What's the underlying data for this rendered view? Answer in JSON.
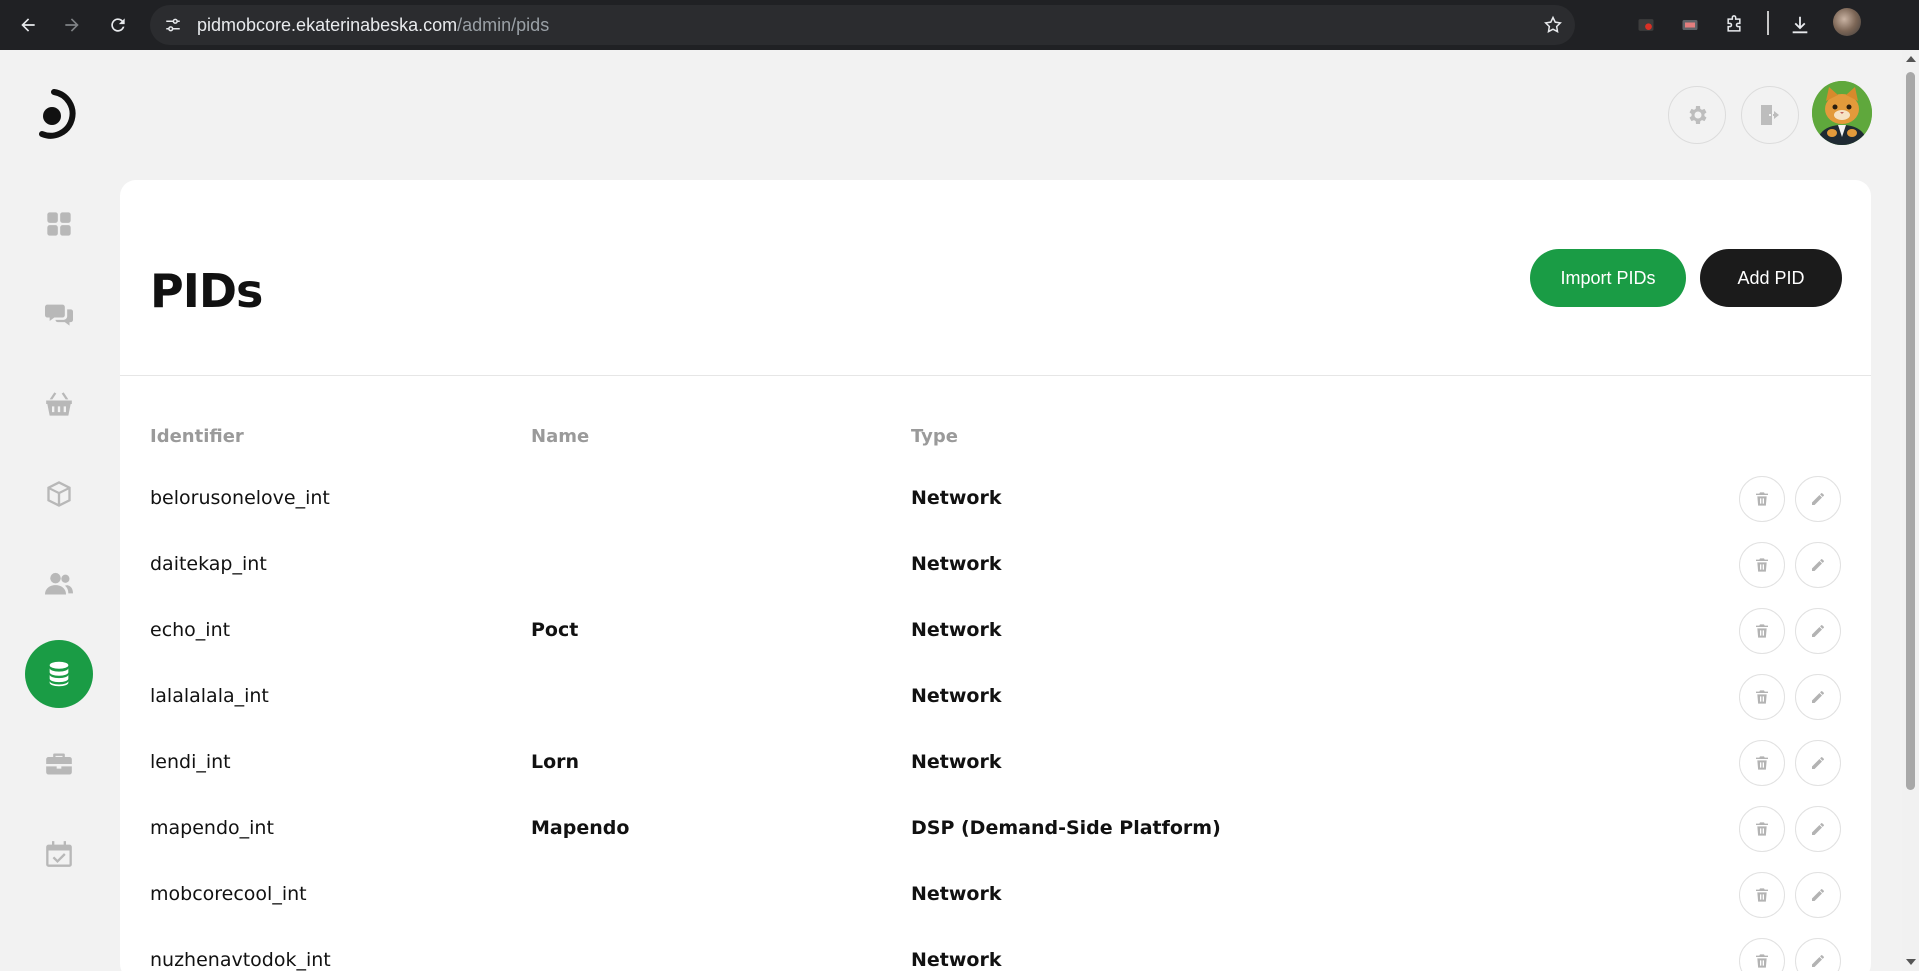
{
  "browser": {
    "url_host": "pidmobcore.ekaterinabeska.com",
    "url_path": "/admin/pids"
  },
  "sidebar": {
    "items": [
      {
        "icon": "dashboard-grid-icon",
        "active": false
      },
      {
        "icon": "chat-bubbles-icon",
        "active": false
      },
      {
        "icon": "basket-icon",
        "active": false
      },
      {
        "icon": "package-box-icon",
        "active": false
      },
      {
        "icon": "users-icon",
        "active": false
      },
      {
        "icon": "database-icon",
        "active": true
      },
      {
        "icon": "briefcase-icon",
        "active": false
      },
      {
        "icon": "calendar-check-icon",
        "active": false
      }
    ]
  },
  "header": {
    "settings_icon": "gear-icon",
    "logout_icon": "logout-door-icon",
    "avatar": "user-avatar"
  },
  "page": {
    "title": "PIDs",
    "import_label": "Import PIDs",
    "add_label": "Add PID"
  },
  "table": {
    "columns": [
      "Identifier",
      "Name",
      "Type"
    ],
    "rows": [
      {
        "identifier": "belorusonelove_int",
        "name": "",
        "type": "Network"
      },
      {
        "identifier": "daitekap_int",
        "name": "",
        "type": "Network"
      },
      {
        "identifier": "echo_int",
        "name": "Poct",
        "type": "Network"
      },
      {
        "identifier": "lalalalala_int",
        "name": "",
        "type": "Network"
      },
      {
        "identifier": "lendi_int",
        "name": "Lorn",
        "type": "Network"
      },
      {
        "identifier": "mapendo_int",
        "name": "Mapendo",
        "type": "DSP (Demand-Side Platform)"
      },
      {
        "identifier": "mobcorecool_int",
        "name": "",
        "type": "Network"
      },
      {
        "identifier": "nuzhenavtodok_int",
        "name": "",
        "type": "Network"
      }
    ]
  },
  "colors": {
    "accent_green": "#1a9c45",
    "dark_button": "#1b1b1b",
    "page_bg": "#f2f2f2"
  }
}
